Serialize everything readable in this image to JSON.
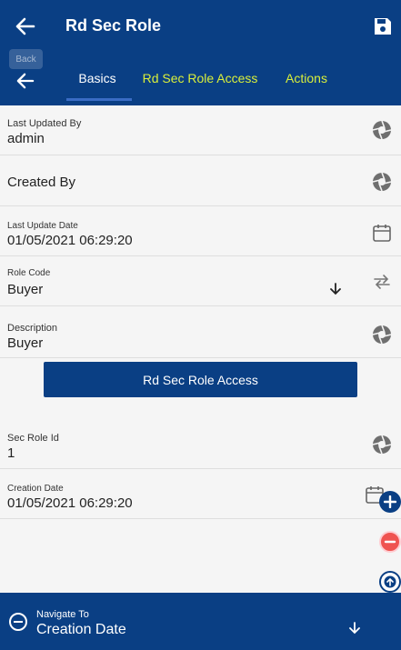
{
  "header": {
    "title": "Rd Sec Role",
    "back_tooltip": "Back"
  },
  "tabs": [
    {
      "label": "Basics"
    },
    {
      "label": "Rd Sec Role Access"
    },
    {
      "label": "Actions"
    }
  ],
  "fields": {
    "last_updated_by": {
      "label": "Last Updated By",
      "value": "admin"
    },
    "created_by": {
      "label": "Created By"
    },
    "last_update_date": {
      "label": "Last Update Date",
      "value": "01/05/2021 06:29:20"
    },
    "role_code": {
      "label": "Role Code",
      "value": "Buyer"
    },
    "description": {
      "label": "Description",
      "value": "Buyer"
    },
    "sec_role_id": {
      "label": "Sec Role Id",
      "value": "1"
    },
    "creation_date": {
      "label": "Creation Date",
      "value": "01/05/2021 06:29:20"
    }
  },
  "access_button": {
    "label": "Rd Sec Role Access"
  },
  "navigate": {
    "label": "Navigate To",
    "value": "Creation Date"
  },
  "colors": {
    "primary": "#0a3f84",
    "tab_inactive": "#d9ef3a",
    "remove": "#e53935"
  },
  "icons": [
    "back-arrow-icon",
    "save-icon",
    "aperture-icon",
    "calendar-icon",
    "sort-down-icon",
    "swap-icon",
    "add-icon",
    "remove-icon",
    "scroll-up-icon",
    "minus-circle-icon",
    "chevron-down-icon"
  ]
}
